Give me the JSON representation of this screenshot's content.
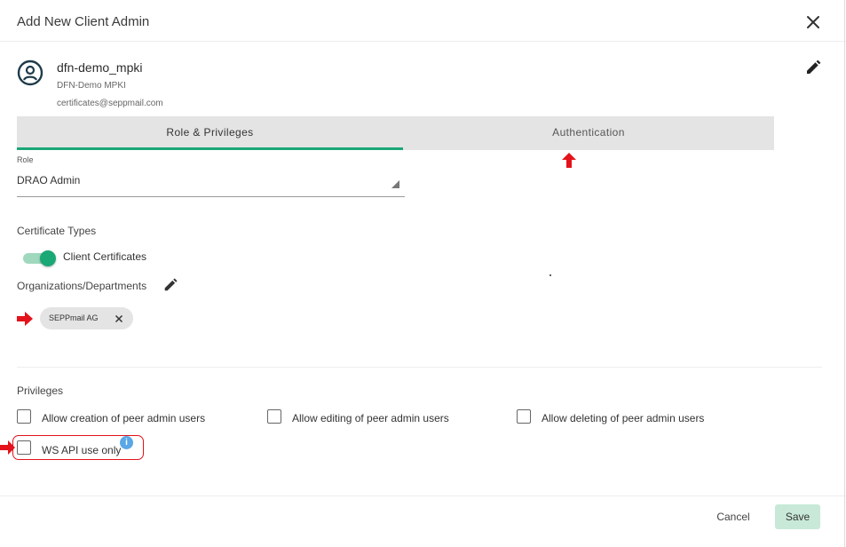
{
  "dialog": {
    "title": "Add New Client Admin"
  },
  "user": {
    "name": "dfn-demo_mpki",
    "org": "DFN-Demo MPKI",
    "email": "certificates@seppmail.com"
  },
  "tabs": [
    {
      "label": "Role & Privileges",
      "active": true
    },
    {
      "label": "Authentication",
      "active": false
    }
  ],
  "role": {
    "label": "Role",
    "value": "DRAO Admin"
  },
  "certificate_types": {
    "title": "Certificate Types",
    "toggle_label": "Client Certificates",
    "toggle_on": true
  },
  "organizations": {
    "title": "Organizations/Departments",
    "chips": [
      "SEPPmail AG"
    ]
  },
  "privileges": {
    "title": "Privileges",
    "items": [
      {
        "label": "Allow creation of peer admin users",
        "checked": false
      },
      {
        "label": "Allow editing of peer admin users",
        "checked": false
      },
      {
        "label": "Allow deleting of peer admin users",
        "checked": false
      },
      {
        "label": "WS API use only",
        "checked": false
      }
    ],
    "info_glyph": "i"
  },
  "footer": {
    "cancel_label": "Cancel",
    "save_label": "Save"
  },
  "colors": {
    "accent": "#1aa876",
    "annotation": "#e4121a",
    "info": "#5aa7e6"
  }
}
